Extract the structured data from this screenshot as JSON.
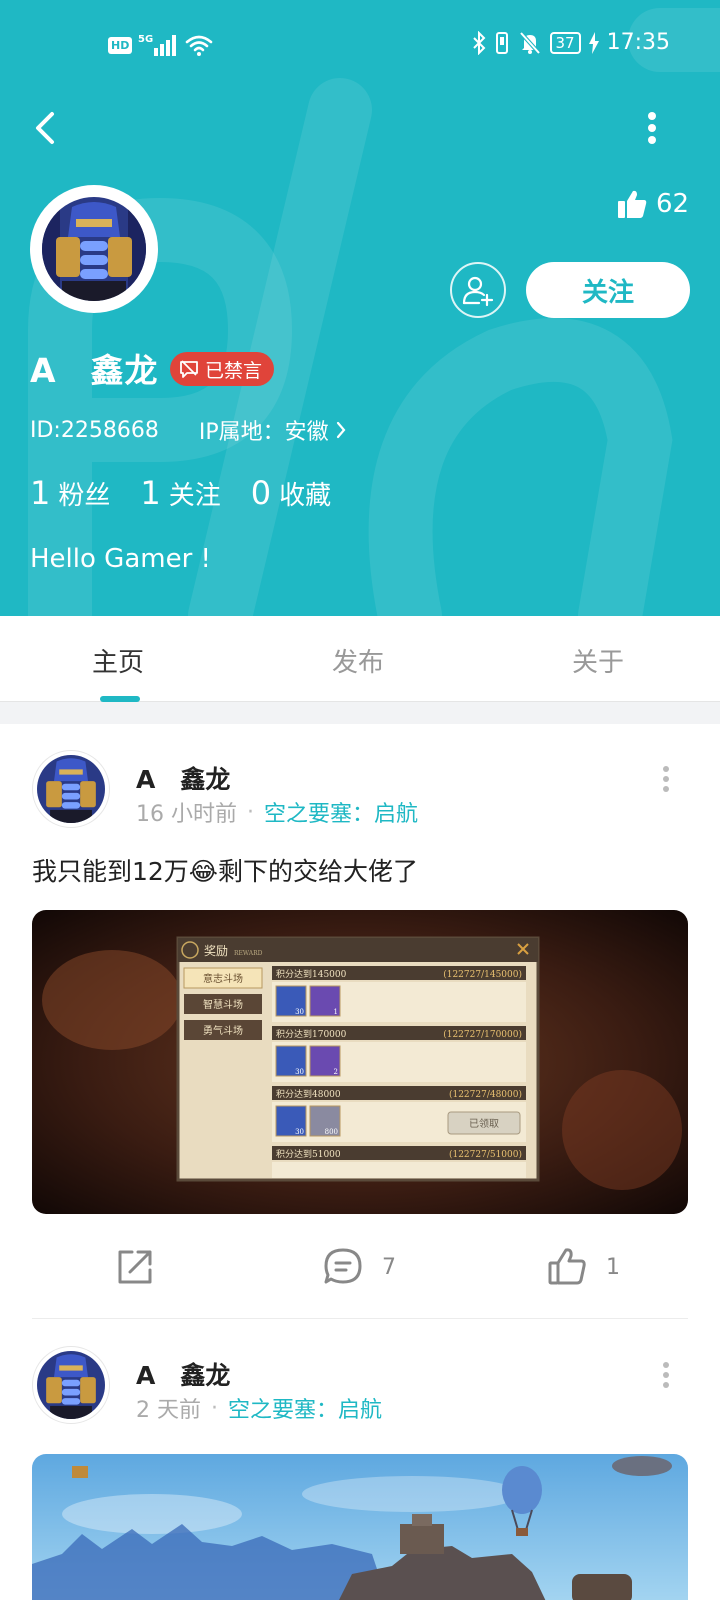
{
  "status_bar": {
    "network_badge": "HD",
    "network_type": "5G",
    "battery_level": "37",
    "time": "17:35",
    "icons": [
      "signal-icon",
      "wifi-icon",
      "bluetooth-icon",
      "vibrate-icon",
      "mute-icon",
      "battery-icon",
      "charging-icon"
    ]
  },
  "colors": {
    "brand": "#1fb8c4",
    "banned": "#e0443a"
  },
  "profile": {
    "likes_count": "62",
    "follow_label": "关注",
    "name": "A　鑫龙",
    "banned_label": "已禁言",
    "id_text": "ID:2258668",
    "ip_text": "IP属地：安徽",
    "stats": [
      {
        "num": "1",
        "label": "粉丝"
      },
      {
        "num": "1",
        "label": "关注"
      },
      {
        "num": "0",
        "label": "收藏"
      }
    ],
    "bio": "Hello Gamer !"
  },
  "tabs": [
    {
      "label": "主页",
      "active": true
    },
    {
      "label": "发布",
      "active": false
    },
    {
      "label": "关于",
      "active": false
    }
  ],
  "posts": [
    {
      "author": "A　鑫龙",
      "time": "16 小时前",
      "game": "空之要塞：启航",
      "text": "我只能到12万😂剩下的交给大佬了",
      "comments": "7",
      "likes": "1",
      "screenshot": {
        "title": "奖励",
        "subtitle": "REWARD",
        "menu": [
          "意志斗场",
          "智慧斗场",
          "勇气斗场"
        ],
        "rows": [
          {
            "goal": "积分达到145000",
            "progress": "(122727/145000)",
            "items": [
              "30",
              "1"
            ],
            "claim": ""
          },
          {
            "goal": "积分达到170000",
            "progress": "(122727/170000)",
            "items": [
              "30",
              "2"
            ],
            "claim": ""
          },
          {
            "goal": "积分达到48000",
            "progress": "(122727/48000)",
            "items": [
              "30",
              "800"
            ],
            "claim": "已领取"
          },
          {
            "goal": "积分达到51000",
            "progress": "(122727/51000)",
            "items": [],
            "claim": ""
          }
        ]
      }
    },
    {
      "author": "A　鑫龙",
      "time": "2 天前",
      "game": "空之要塞：启航"
    }
  ]
}
